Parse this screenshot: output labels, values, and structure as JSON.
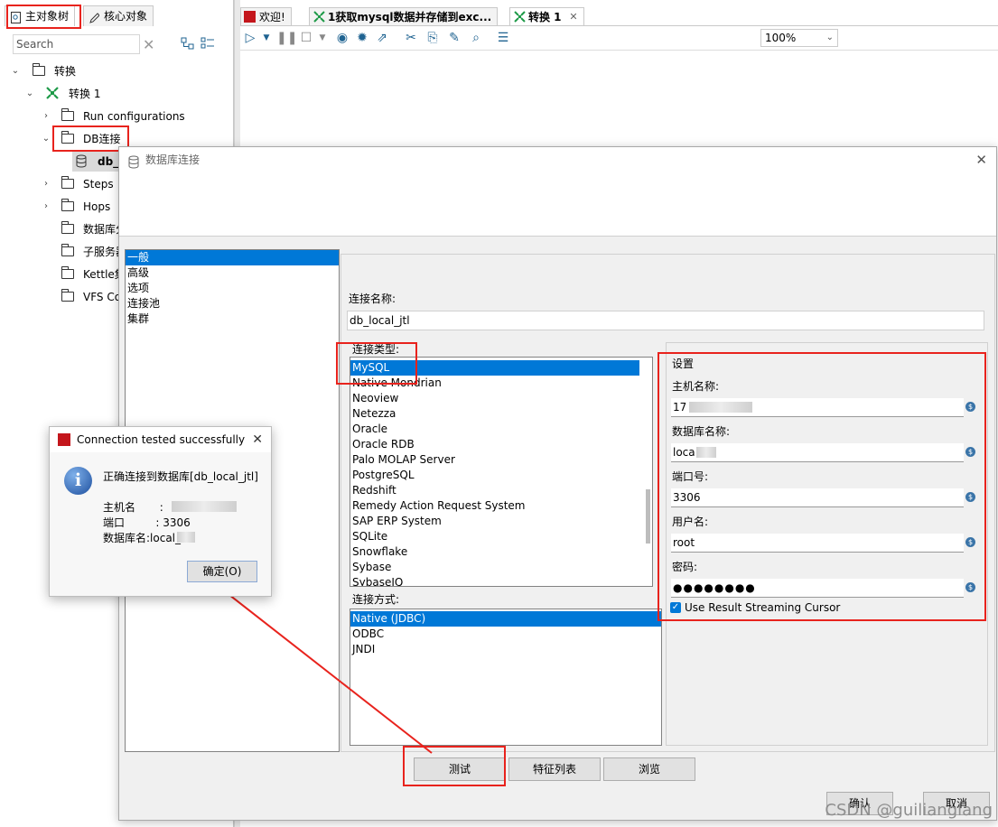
{
  "left_panel": {
    "tabs": [
      "主对象树",
      "核心对象"
    ],
    "search_placeholder": "Search",
    "tree": {
      "root": "转换",
      "trans": "转换 1",
      "run_configs": "Run configurations",
      "db_conn": "DB连接",
      "db_item": "db_l",
      "steps": "Steps",
      "hops": "Hops",
      "db_partition": "数据库分",
      "subservers": "子服务器",
      "kettle_cluster": "Kettle集",
      "vfs": "VFS Co"
    }
  },
  "editor": {
    "tabs": [
      "欢迎!",
      "1获取mysql数据并存储到exc...",
      "转换 1"
    ],
    "zoom": "100%"
  },
  "dialog": {
    "title": "数据库连接",
    "nav": [
      "一般",
      "高级",
      "选项",
      "连接池",
      "集群"
    ],
    "conn_name_label": "连接名称:",
    "conn_name_value": "db_local_jtl",
    "conn_type_label": "连接类型:",
    "conn_types": [
      "MySQL",
      "Native Mondrian",
      "Neoview",
      "Netezza",
      "Oracle",
      "Oracle RDB",
      "Palo MOLAP Server",
      "PostgreSQL",
      "Redshift",
      "Remedy Action Request System",
      "SAP ERP System",
      "SQLite",
      "Snowflake",
      "Sybase",
      "SybaseIQ"
    ],
    "access_label": "连接方式:",
    "access_types": [
      "Native (JDBC)",
      "ODBC",
      "JNDI"
    ],
    "settings": {
      "title": "设置",
      "host_label": "主机名称:",
      "host_value": "17",
      "db_label": "数据库名称:",
      "db_value": "loca",
      "port_label": "端口号:",
      "port_value": "3306",
      "user_label": "用户名:",
      "user_value": "root",
      "pass_label": "密码:",
      "pass_value": "●●●●●●●●",
      "streaming_label": "Use Result Streaming Cursor",
      "streaming_checked": true
    },
    "buttons": {
      "test": "测试",
      "features": "特征列表",
      "browse": "浏览",
      "ok": "确认",
      "cancel": "取消"
    }
  },
  "popup": {
    "title": "Connection tested successfully",
    "message": "正确连接到数据库[db_local_jtl]",
    "host_line": "主机名       :",
    "port_line": "端口         : 3306",
    "db_line": "数据库名:local_",
    "ok_button": "确定(O)"
  },
  "watermark": "CSDN @guilianglang",
  "colors": {
    "selection": "#0078d7",
    "annotation": "#e8231d"
  }
}
